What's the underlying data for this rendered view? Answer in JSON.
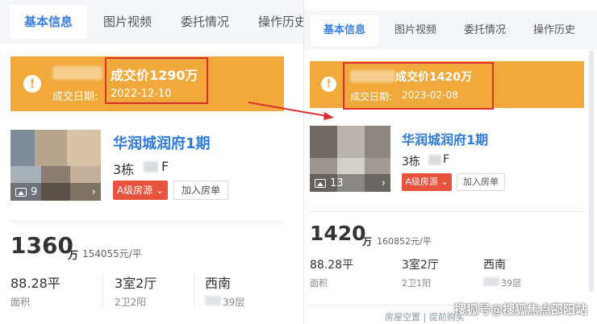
{
  "left": {
    "tabs": [
      {
        "label": "基本信息"
      },
      {
        "label": "图片视频"
      },
      {
        "label": "委托情况"
      },
      {
        "label": "操作历史"
      }
    ],
    "alert": {
      "icon": "alert-icon",
      "title": "成交价1290万",
      "date_label": "成交日期:",
      "date": "2022-12-10"
    },
    "listing": {
      "image_count": "9",
      "project_name": "华润城润府1期",
      "building": "3栋",
      "unit_suffix": "F",
      "grade_label": "A级房源",
      "add_to_list_label": "加入房单"
    },
    "price": {
      "total": "1360",
      "unit": "万",
      "unit_price": "154055元/平"
    },
    "stats": [
      {
        "value": "88.28平",
        "label": "面积"
      },
      {
        "value": "3室2厅",
        "label": "2卫2阳"
      },
      {
        "value": "西南",
        "label": "39层"
      }
    ]
  },
  "right": {
    "tabs": [
      {
        "label": "基本信息"
      },
      {
        "label": "图片视频"
      },
      {
        "label": "委托情况"
      },
      {
        "label": "操作历史"
      }
    ],
    "alert": {
      "icon": "alert-icon",
      "title": "成交价1420万",
      "date_label": "成交日期:",
      "date": "2023-02-08"
    },
    "listing": {
      "image_count": "13",
      "project_name": "华润城润府1期",
      "building": "3栋",
      "unit_suffix": "F",
      "grade_label": "A级房源",
      "add_to_list_label": "加入房单"
    },
    "price": {
      "total": "1420",
      "unit": "万",
      "unit_price": "160852元/平"
    },
    "stats": [
      {
        "value": "88.28平",
        "label": "面积"
      },
      {
        "value": "3室2厅",
        "label": "2卫1阳"
      },
      {
        "value": "西南",
        "label": "39层"
      }
    ],
    "bottom_links": "房屋空置 | 提前购买"
  },
  "colors": {
    "accent_blue": "#2f7bd9",
    "alert_orange": "#f0a93a",
    "highlight_red": "#e0302c",
    "grade_red": "#e8533e"
  },
  "watermark": "搜狐号@搜狐焦点邵阳站"
}
